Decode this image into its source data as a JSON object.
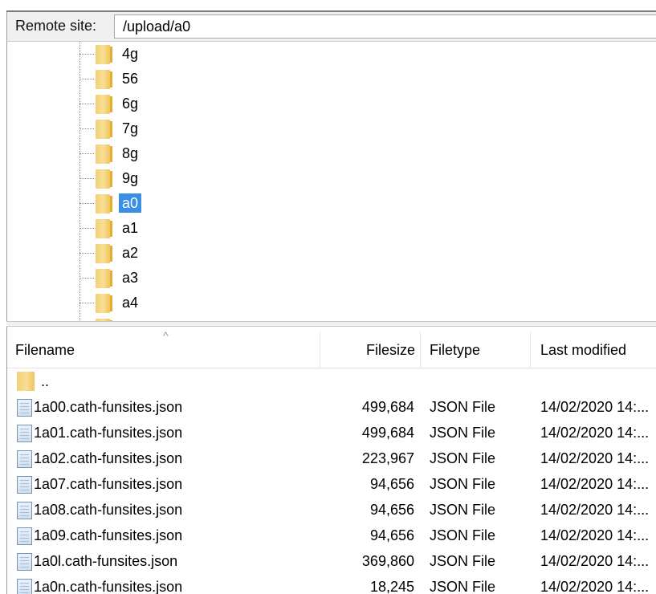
{
  "remote_site": {
    "label": "Remote site:",
    "path": "/upload/a0"
  },
  "tree": {
    "folders": [
      {
        "name": "4g"
      },
      {
        "name": "56"
      },
      {
        "name": "6g"
      },
      {
        "name": "7g"
      },
      {
        "name": "8g"
      },
      {
        "name": "9g"
      },
      {
        "name": "a0",
        "selected": true
      },
      {
        "name": "a1"
      },
      {
        "name": "a2"
      },
      {
        "name": "a3"
      },
      {
        "name": "a4"
      }
    ]
  },
  "file_list": {
    "columns": {
      "filename": "Filename",
      "filesize": "Filesize",
      "filetype": "Filetype",
      "last_modified": "Last modified"
    },
    "parent_dir": "..",
    "files": [
      {
        "name": "1a00.cath-funsites.json",
        "size": "499,684",
        "type": "JSON File",
        "modified": "14/02/2020 14:..."
      },
      {
        "name": "1a01.cath-funsites.json",
        "size": "499,684",
        "type": "JSON File",
        "modified": "14/02/2020 14:..."
      },
      {
        "name": "1a02.cath-funsites.json",
        "size": "223,967",
        "type": "JSON File",
        "modified": "14/02/2020 14:..."
      },
      {
        "name": "1a07.cath-funsites.json",
        "size": "94,656",
        "type": "JSON File",
        "modified": "14/02/2020 14:..."
      },
      {
        "name": "1a08.cath-funsites.json",
        "size": "94,656",
        "type": "JSON File",
        "modified": "14/02/2020 14:..."
      },
      {
        "name": "1a09.cath-funsites.json",
        "size": "94,656",
        "type": "JSON File",
        "modified": "14/02/2020 14:..."
      },
      {
        "name": "1a0l.cath-funsites.json",
        "size": "369,860",
        "type": "JSON File",
        "modified": "14/02/2020 14:..."
      },
      {
        "name": "1a0n.cath-funsites.json",
        "size": "18,245",
        "type": "JSON File",
        "modified": "14/02/2020 14:..."
      }
    ]
  },
  "colors": {
    "selection": "#3a8ee6",
    "folder": "#f2d078",
    "panel_bg": "#f0f0f0"
  },
  "icons": {
    "folder": "folder-icon",
    "file": "json-file-icon",
    "sort": "sort-ascending-icon"
  }
}
